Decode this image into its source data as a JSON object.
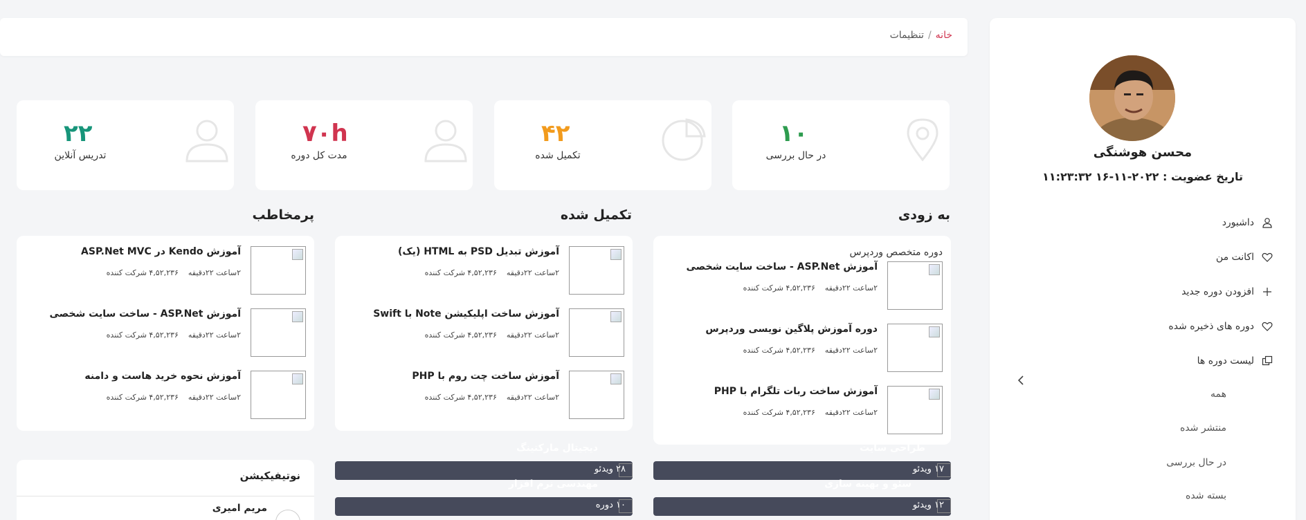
{
  "breadcrumb": {
    "home": "خانه",
    "separator": "/",
    "current": "تنظیمات"
  },
  "stats": [
    {
      "value": "۱۰",
      "label": "در حال بررسی",
      "color": "#2e9c4f",
      "icon": "location-pin-icon"
    },
    {
      "value": "۴۲",
      "label": "تکمیل شده",
      "color": "#f29b1d",
      "icon": "pie-chart-icon"
    },
    {
      "value": "۷۰h",
      "label": "مدت کل دوره",
      "color": "#d0344f",
      "icon": "user-icon"
    },
    {
      "value": "۲۲",
      "label": "تدریس آنلاین",
      "color": "#17957a",
      "icon": "user-icon"
    }
  ],
  "sections": {
    "coming_soon": {
      "title": "به زودی",
      "group_label": "دوره متخصص وردپرس",
      "courses": [
        {
          "title": "آموزش ASP.Net - ساخت سایت شخصی",
          "duration": "۲ساعت ۲۲دقیقه",
          "participants": "۴,۵۲,۲۳۶ شرکت کننده"
        },
        {
          "title": "دوره آموزش پلاگین نویسی وردپرس",
          "duration": "۲ساعت ۲۲دقیقه",
          "participants": "۴,۵۲,۲۳۶ شرکت کننده"
        },
        {
          "title": "آموزش ساخت ربات تلگرام با PHP",
          "duration": "۲ساعت ۲۲دقیقه",
          "participants": "۴,۵۲,۲۳۶ شرکت کننده"
        }
      ]
    },
    "completed": {
      "title": "تکمیل شده",
      "courses": [
        {
          "title": "آموزش تبدیل PSD به HTML (یک)",
          "duration": "۲ساعت ۲۲دقیقه",
          "participants": "۴,۵۲,۲۳۶ شرکت کننده"
        },
        {
          "title": "آموزش ساخت اپلیکیشن Note با Swift",
          "duration": "۲ساعت ۲۲دقیقه",
          "participants": "۴,۵۲,۲۳۶ شرکت کننده"
        },
        {
          "title": "آموزش ساخت چت روم با PHP",
          "duration": "۲ساعت ۲۲دقیقه",
          "participants": "۴,۵۲,۲۳۶ شرکت کننده"
        }
      ]
    },
    "popular": {
      "title": "پرمخاطب",
      "courses": [
        {
          "title": "آموزش Kendo در ASP.Net MVC",
          "duration": "۲ساعت ۲۲دقیقه",
          "participants": "۴,۵۲,۲۳۶ شرکت کننده"
        },
        {
          "title": "آموزش ASP.Net - ساخت سایت شخصی",
          "duration": "۲ساعت ۲۲دقیقه",
          "participants": "۴,۵۲,۲۳۶ شرکت کننده"
        },
        {
          "title": "آموزش نحوه خرید هاست و دامنه",
          "duration": "۲ساعت ۲۲دقیقه",
          "participants": "۴,۵۲,۲۳۶ شرکت کننده"
        }
      ]
    }
  },
  "category_bars": [
    {
      "title": "طراحی سایت",
      "count": "۱۷ ویدئو"
    },
    {
      "title": "دیجیتال مارکتینگ",
      "count": "۲۸ ویدئو"
    },
    {
      "title": "سئو و بهینه سازی",
      "count": "۱۲ ویدئو"
    },
    {
      "title": "مهندسی نرم افزار",
      "count": "۱۰ دوره"
    }
  ],
  "notifications": {
    "title": "نوتیفیکیشن",
    "first_name": "مریم امیری"
  },
  "profile": {
    "name": "محسن هوشنگی",
    "join_date": "تاریخ عضویت : ۲۰۲۲-۱۱-۱۶ ۱۱:۲۳:۳۲"
  },
  "menu": {
    "dashboard": "داشبورد",
    "account": "اکانت من",
    "add_course": "افزودن دوره جدید",
    "saved": "دوره های ذخیره شده",
    "course_list": "لیست دوره ها",
    "sub": {
      "all": "همه",
      "published": "منتشر شده",
      "review": "در حال بررسی",
      "closed": "بسته شده"
    }
  }
}
